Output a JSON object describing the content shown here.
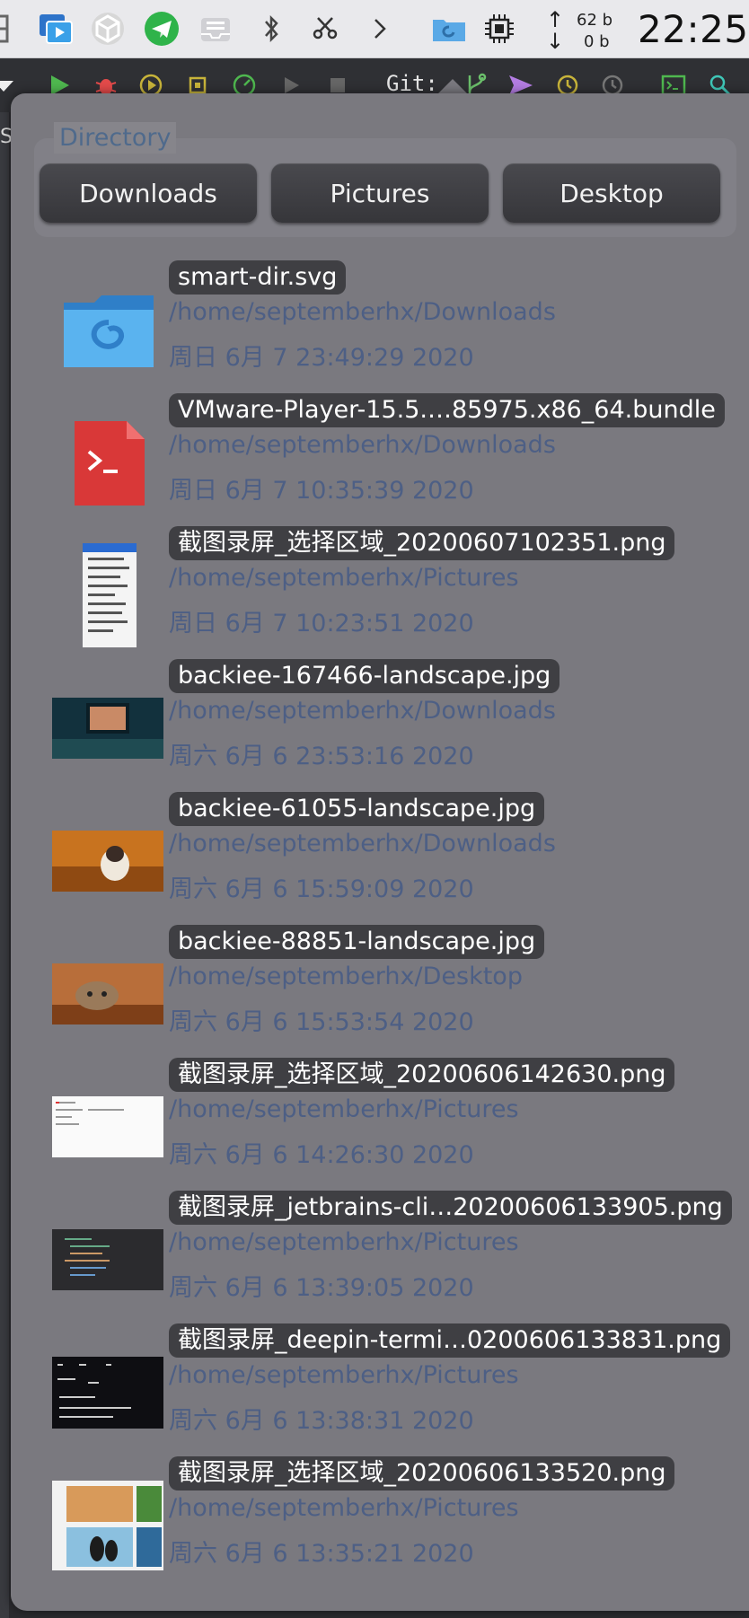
{
  "topbar": {
    "icons": [
      "grid-icon",
      "screen-recorder-icon",
      "cube-icon",
      "telegram-icon",
      "inbox-icon",
      "bluetooth-icon",
      "scissors-icon",
      "chevron-right-icon",
      "smart-dir-icon",
      "chip-icon"
    ],
    "net_up_symbol": "↑",
    "net_down_symbol": "↓",
    "net_up": "62 b",
    "net_down": "0 b",
    "clock": "22:25"
  },
  "ide": {
    "git_label": "Git:",
    "left_letter": "S"
  },
  "directory": {
    "title": "Directory",
    "buttons": [
      "Downloads",
      "Pictures",
      "Desktop"
    ]
  },
  "files": [
    {
      "name": "smart-dir.svg",
      "path": "/home/septemberhx/Downloads",
      "date": "周日 6月 7 23:49:29 2020",
      "thumb": "folder-icon"
    },
    {
      "name": "VMware-Player-15.5.…85975.x86_64.bundle",
      "path": "/home/septemberhx/Downloads",
      "date": "周日 6月 7 10:35:39 2020",
      "thumb": "terminal-file-icon"
    },
    {
      "name": "截图录屏_选择区域_20200607102351.png",
      "path": "/home/septemberhx/Pictures",
      "date": "周日 6月 7 10:23:51 2020",
      "thumb": "screenshot-thumb"
    },
    {
      "name": "backiee-167466-landscape.jpg",
      "path": "/home/septemberhx/Downloads",
      "date": "周六 6月 6 23:53:16 2020",
      "thumb": "landscape-thumb"
    },
    {
      "name": "backiee-61055-landscape.jpg",
      "path": "/home/septemberhx/Downloads",
      "date": "周六 6月 6 15:59:09 2020",
      "thumb": "cat-autumn-thumb"
    },
    {
      "name": "backiee-88851-landscape.jpg",
      "path": "/home/septemberhx/Desktop",
      "date": "周六 6月 6 15:53:54 2020",
      "thumb": "cat-table-thumb"
    },
    {
      "name": "截图录屏_选择区域_20200606142630.png",
      "path": "/home/septemberhx/Pictures",
      "date": "周六 6月 6 14:26:30 2020",
      "thumb": "document-thumb"
    },
    {
      "name": "截图录屏_jetbrains-cli…20200606133905.png",
      "path": "/home/septemberhx/Pictures",
      "date": "周六 6月 6 13:39:05 2020",
      "thumb": "ide-thumb"
    },
    {
      "name": "截图录屏_deepin-termi…0200606133831.png",
      "path": "/home/septemberhx/Pictures",
      "date": "周六 6月 6 13:38:31 2020",
      "thumb": "terminal-thumb"
    },
    {
      "name": "截图录屏_选择区域_20200606133520.png",
      "path": "/home/septemberhx/Pictures",
      "date": "周六 6月 6 13:35:21 2020",
      "thumb": "photo-grid-thumb"
    }
  ],
  "colors": {
    "popup_bg": "#7a797f",
    "path_text": "#4d5f85",
    "name_bg": "#3f3f43"
  }
}
